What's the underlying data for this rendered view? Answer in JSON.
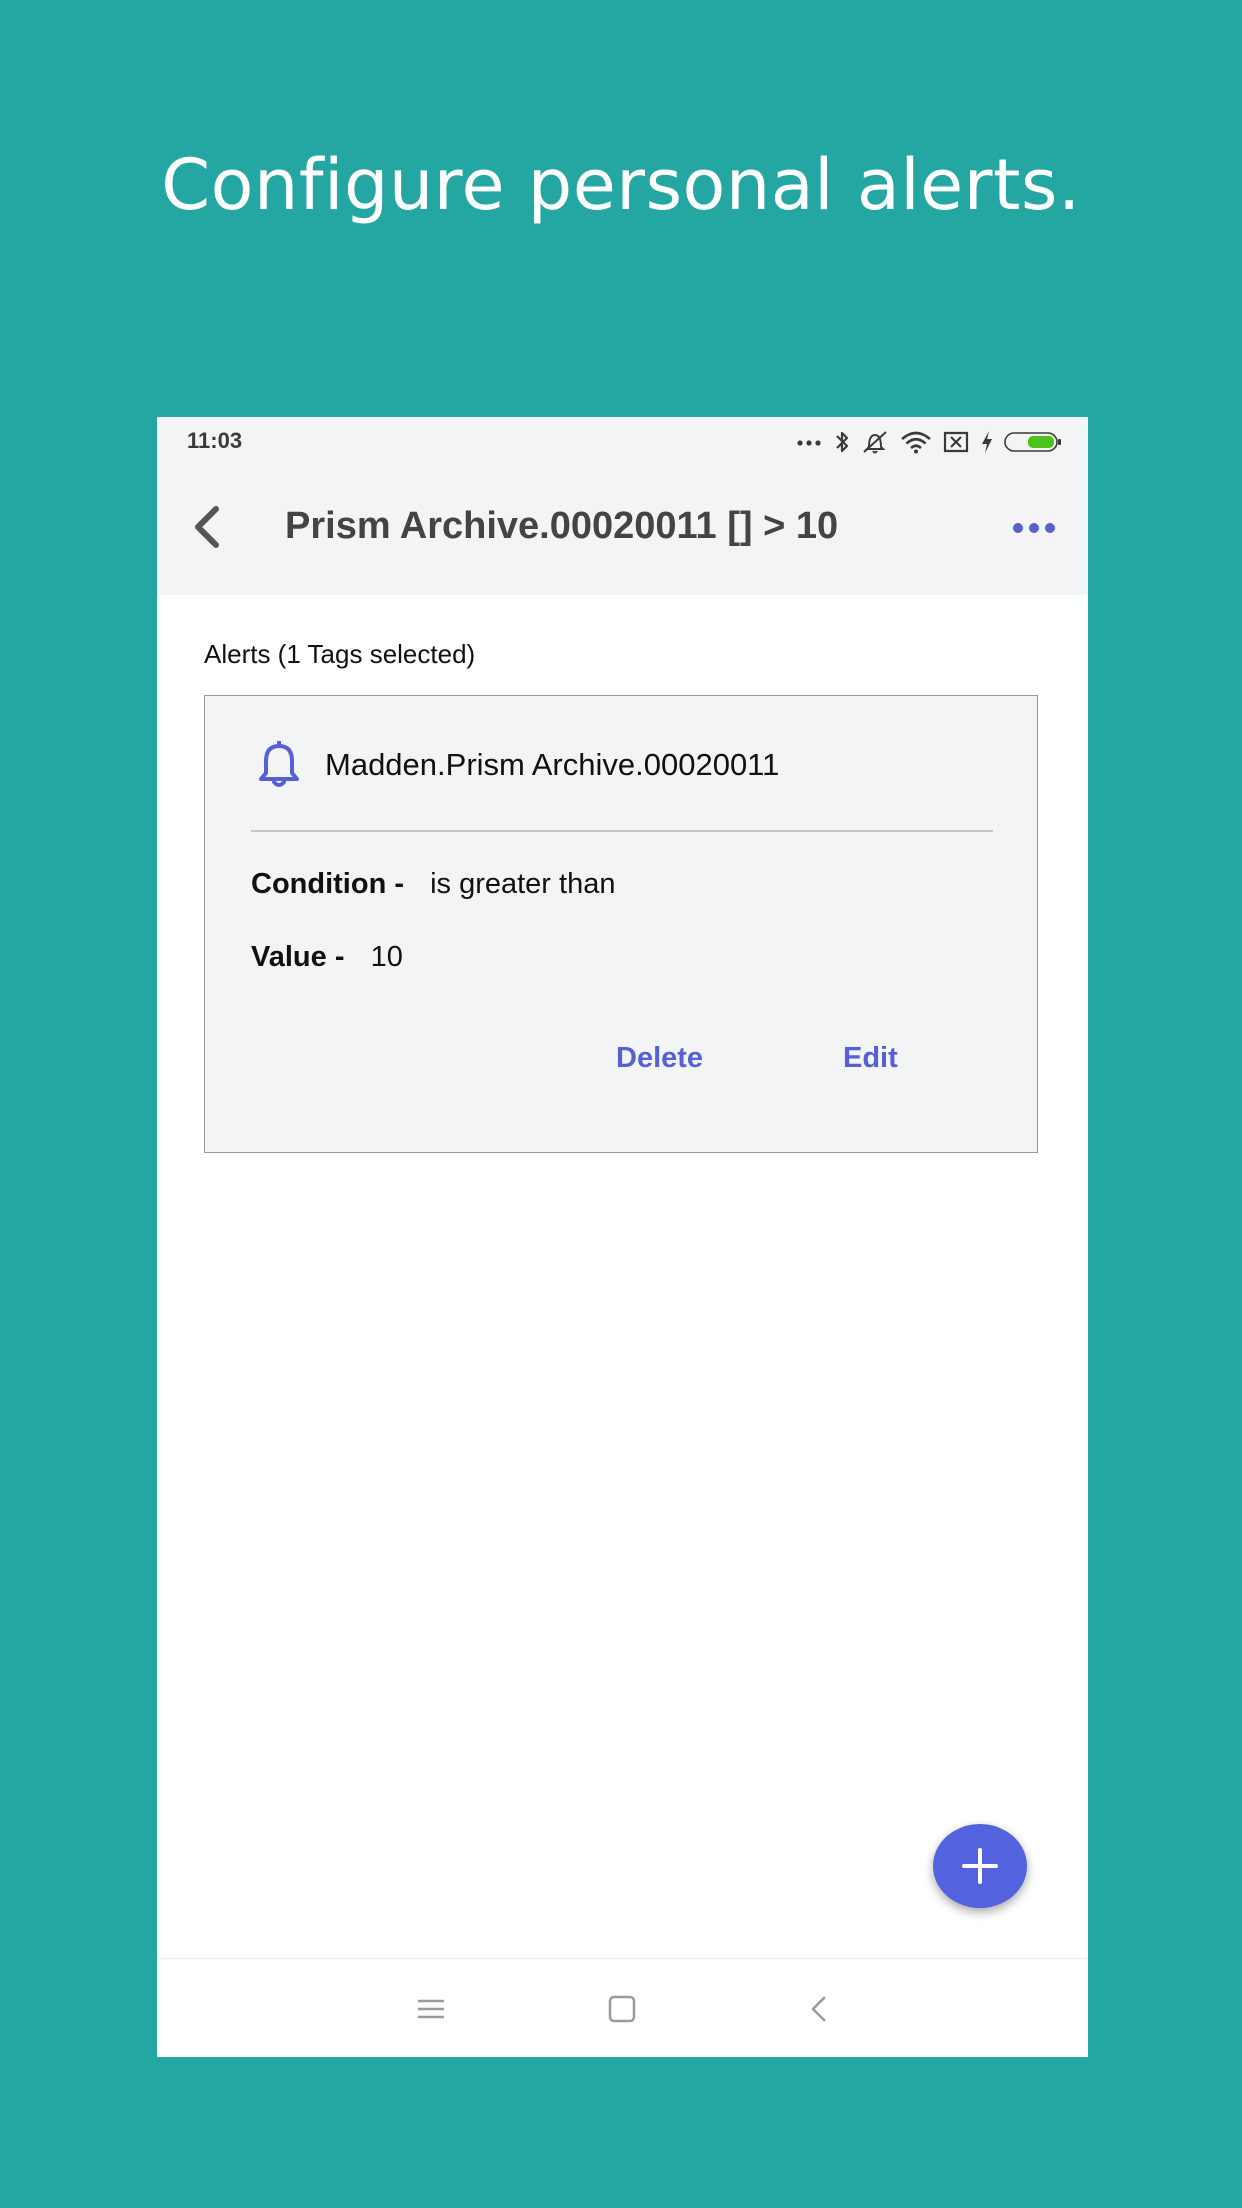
{
  "headline": "Configure personal alerts.",
  "status_bar": {
    "time": "11:03",
    "icons": [
      "more-dots-icon",
      "bluetooth-icon",
      "vibrate-off-icon",
      "wifi-icon",
      "sim-off-icon",
      "charging-icon",
      "battery-icon"
    ]
  },
  "app_bar": {
    "back_icon": "chevron-left-icon",
    "title": "Prism Archive.00020011 [] > 10",
    "menu_icon": "more-horizontal-icon"
  },
  "alerts": {
    "section_label": "Alerts (1 Tags selected)",
    "items": [
      {
        "icon": "bell-icon",
        "tag": "Madden.Prism Archive.00020011",
        "condition_label": "Condition -",
        "condition_value": "is greater than",
        "value_label": "Value -",
        "value": "10",
        "delete_label": "Delete",
        "edit_label": "Edit"
      }
    ]
  },
  "fab": {
    "icon": "plus-icon"
  },
  "nav_bar": {
    "icons": [
      "menu-icon",
      "home-square-icon",
      "back-chevron-icon"
    ]
  },
  "colors": {
    "background": "#24a7a2",
    "accent": "#5560d6",
    "fab": "#5363e0",
    "bar": "#f3f4f6",
    "battery": "#4cc21a"
  }
}
